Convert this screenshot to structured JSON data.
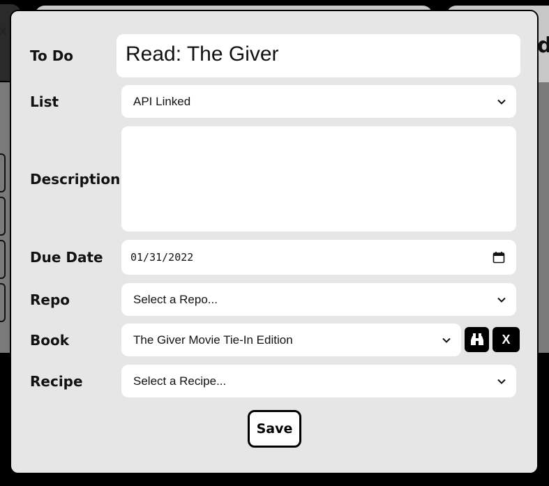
{
  "background": {
    "left_glyph": "x",
    "right_glyph": "d"
  },
  "form": {
    "todo": {
      "label": "To Do",
      "value": "Read: The Giver"
    },
    "list": {
      "label": "List",
      "selected": "API Linked"
    },
    "description": {
      "label": "Description",
      "value": ""
    },
    "due_date": {
      "label": "Due Date",
      "value": "01/31/2022"
    },
    "repo": {
      "label": "Repo",
      "selected": "Select a Repo..."
    },
    "book": {
      "label": "Book",
      "selected": "The Giver Movie Tie-In Edition",
      "search_icon": "binoculars-icon",
      "clear_label": "X"
    },
    "recipe": {
      "label": "Recipe",
      "selected": "Select a Recipe..."
    },
    "save_label": "Save"
  }
}
